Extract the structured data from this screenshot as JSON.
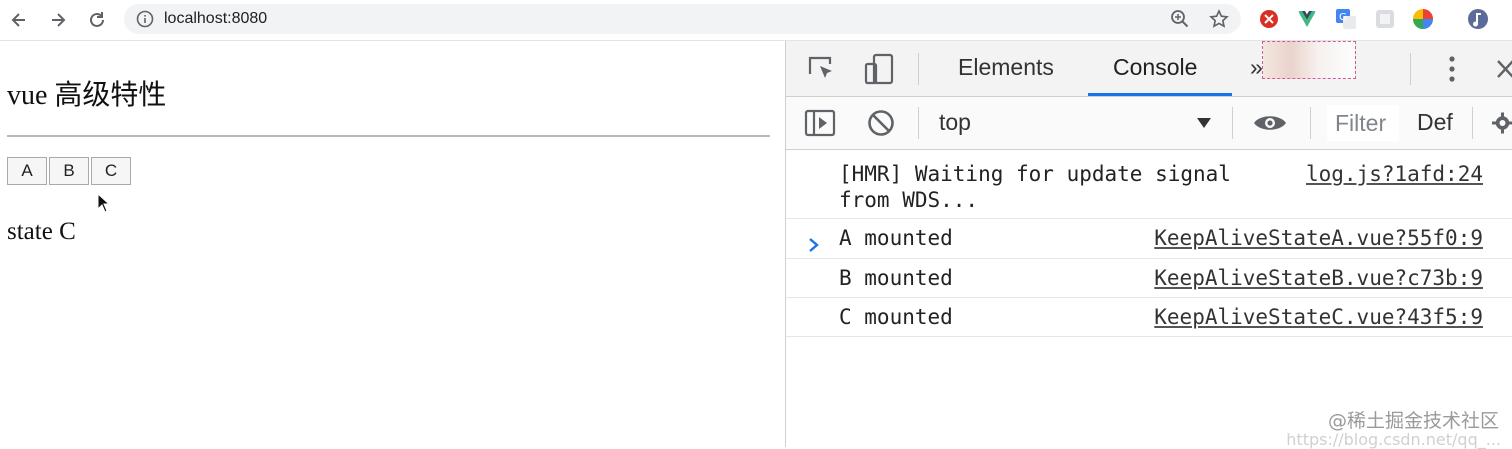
{
  "browser": {
    "url": "localhost:8080"
  },
  "page": {
    "title": "vue 高级特性",
    "buttons": [
      "A",
      "B",
      "C"
    ],
    "state_text": "state C"
  },
  "devtools": {
    "tabs": {
      "elements": "Elements",
      "console": "Console",
      "more": "»"
    },
    "toolbar": {
      "context": "top",
      "filter_placeholder": "Filter",
      "levels": "Def"
    },
    "logs": [
      {
        "message": "[HMR] Waiting for update signal\nfrom WDS...",
        "source": "log.js?1afd:24"
      },
      {
        "message": "A mounted",
        "source": "KeepAliveStateA.vue?55f0:9"
      },
      {
        "message": "B mounted",
        "source": "KeepAliveStateB.vue?c73b:9"
      },
      {
        "message": "C mounted",
        "source": "KeepAliveStateC.vue?43f5:9"
      }
    ]
  },
  "watermark": {
    "text": "@稀土掘金技术社区",
    "url_faint": "https://blog.csdn.net/qq_..."
  },
  "colors": {
    "accent": "#1a73e8",
    "prompt": "#1a73e8"
  }
}
